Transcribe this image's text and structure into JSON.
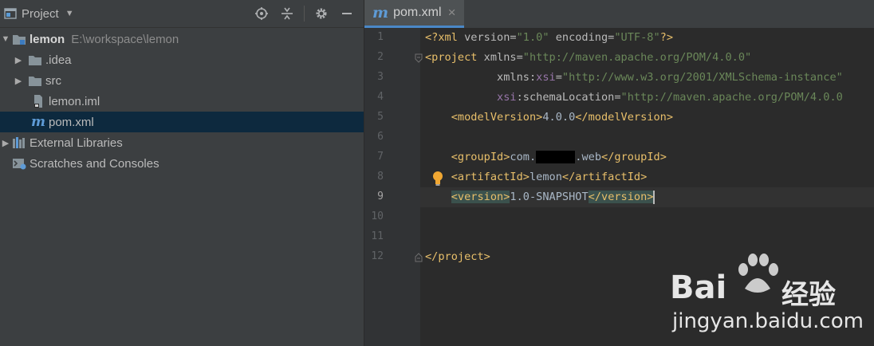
{
  "project_panel": {
    "title": "Project",
    "toolbar_icons": [
      "locate-icon",
      "collapse-all-icon",
      "settings-icon",
      "hide-icon"
    ],
    "tree": [
      {
        "name": "lemon",
        "path": "E:\\workspace\\lemon",
        "kind": "module",
        "expanded": true
      },
      {
        "name": ".idea",
        "kind": "folder",
        "expanded": false
      },
      {
        "name": "src",
        "kind": "folder",
        "expanded": false
      },
      {
        "name": "lemon.iml",
        "kind": "iml-file"
      },
      {
        "name": "pom.xml",
        "kind": "maven-file",
        "selected": true
      },
      {
        "name": "External Libraries",
        "kind": "libraries",
        "expanded": false
      },
      {
        "name": "Scratches and Consoles",
        "kind": "scratches"
      }
    ]
  },
  "editor": {
    "tab": {
      "icon_letter": "m",
      "title": "pom.xml",
      "close_glyph": "×"
    },
    "current_line": 9,
    "line_numbers": [
      "1",
      "2",
      "3",
      "4",
      "5",
      "6",
      "7",
      "8",
      "9",
      "10",
      "11",
      "12"
    ],
    "lines": {
      "l1_pi_open": "<?xml ",
      "l1_attr1": "version=",
      "l1_val1": "\"1.0\"",
      "l1_attr2": " encoding=",
      "l1_val2": "\"UTF-8\"",
      "l1_pi_close": "?>",
      "l2_open": "<project ",
      "l2_attr": "xmlns=",
      "l2_val": "\"http://maven.apache.org/POM/4.0.0\"",
      "l3_attr": "xmlns:",
      "l3_ns": "xsi",
      "l3_eq": "=",
      "l3_val": "\"http://www.w3.org/2001/XMLSchema-instance\"",
      "l4_ns": "xsi",
      "l4_attr": ":schemaLocation=",
      "l4_val": "\"http://maven.apache.org/POM/4.0.0",
      "l5_open": "<modelVersion>",
      "l5_text": "4.0.0",
      "l5_close": "</modelVersion>",
      "l7_open": "<groupId>",
      "l7_text1": "com.",
      "l7_redacted": "xxxxxx",
      "l7_text2": ".web",
      "l7_close": "</groupId>",
      "l8_open": "<artifactId>",
      "l8_text": "lemon",
      "l8_close": "</artifactId>",
      "l9_open": "<version>",
      "l9_text": "1.0-SNAPSHOT",
      "l9_close": "</version>",
      "l12_close": "</project>"
    },
    "intention_icon": "lightbulb-icon"
  },
  "watermark": {
    "logo_text_left": "Bai",
    "logo_text_right": "经验",
    "url": "jingyan.baidu.com"
  },
  "colors": {
    "panel_bg": "#3c3f41",
    "editor_bg": "#2b2b2b",
    "selection": "#0d293e",
    "tag": "#e8bf6a",
    "string": "#6a8759",
    "accent": "#4a88c7"
  }
}
